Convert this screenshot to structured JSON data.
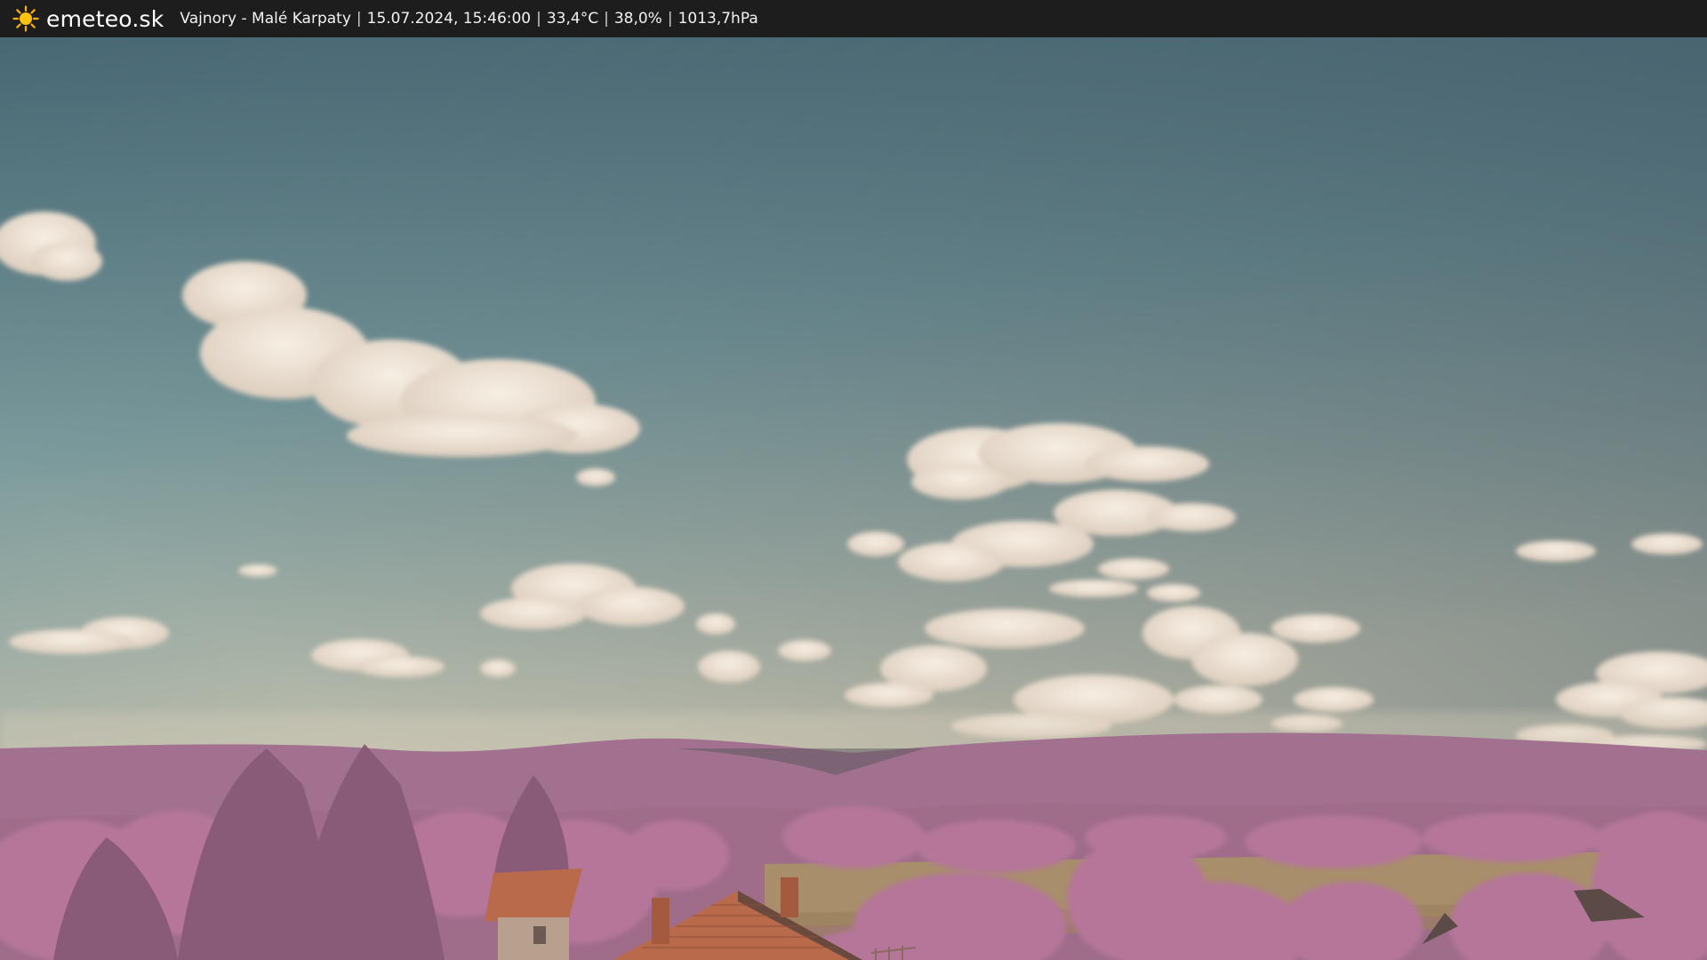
{
  "header": {
    "brand": "emeteo.sk",
    "logo_icon": "sun-icon",
    "location": "Vajnory - Malé Karpaty",
    "datetime": "15.07.2024, 15:46:00",
    "temperature": "33,4°C",
    "humidity": "38,0%",
    "pressure": "1013,7hPa",
    "separator": "|"
  },
  "webcam": {
    "content": "infrared-sky-landscape",
    "colors": {
      "sky_top": "#4b6c78",
      "sky_mid": "#7a9a9c",
      "sky_horizon": "#c6c2ae",
      "hills": "#a37190",
      "foliage": "#b5769a",
      "field": "#a88e6a",
      "roof": "#b96a4a",
      "cloud": "#f2e8dc"
    }
  }
}
